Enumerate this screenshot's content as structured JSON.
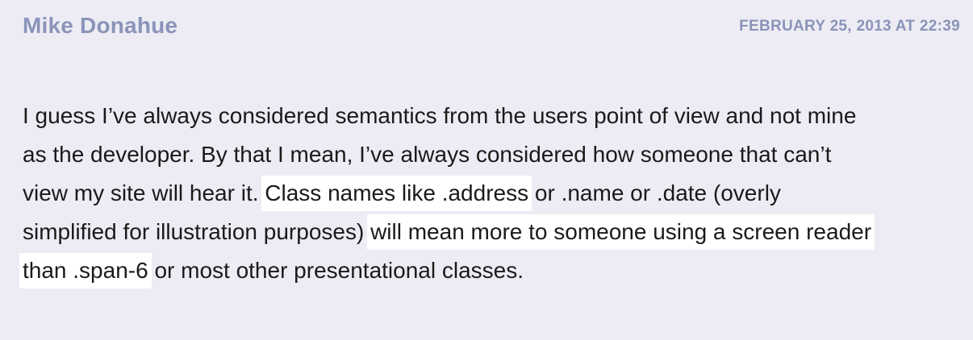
{
  "comment": {
    "author": "Mike Donahue",
    "timestamp": "FEBRUARY 25, 2013 AT 22:39",
    "body": {
      "part1": "I guess I’ve always considered semantics from the users point of view and not mine as the developer. By that I mean, I’ve always considered how someone that can’t view my site will hear it. ",
      "highlight1": "Class names like .address",
      "part2": " or .name or .date (overly simplified for illustration purposes) ",
      "highlight2": "will mean more to someone using a screen reader than .span-6",
      "part3": " or most other presentational classes."
    }
  },
  "colors": {
    "background": "#edecf5",
    "meta_text": "#8a94b8",
    "body_text": "#1a1a1a",
    "highlight": "#ffffff"
  }
}
